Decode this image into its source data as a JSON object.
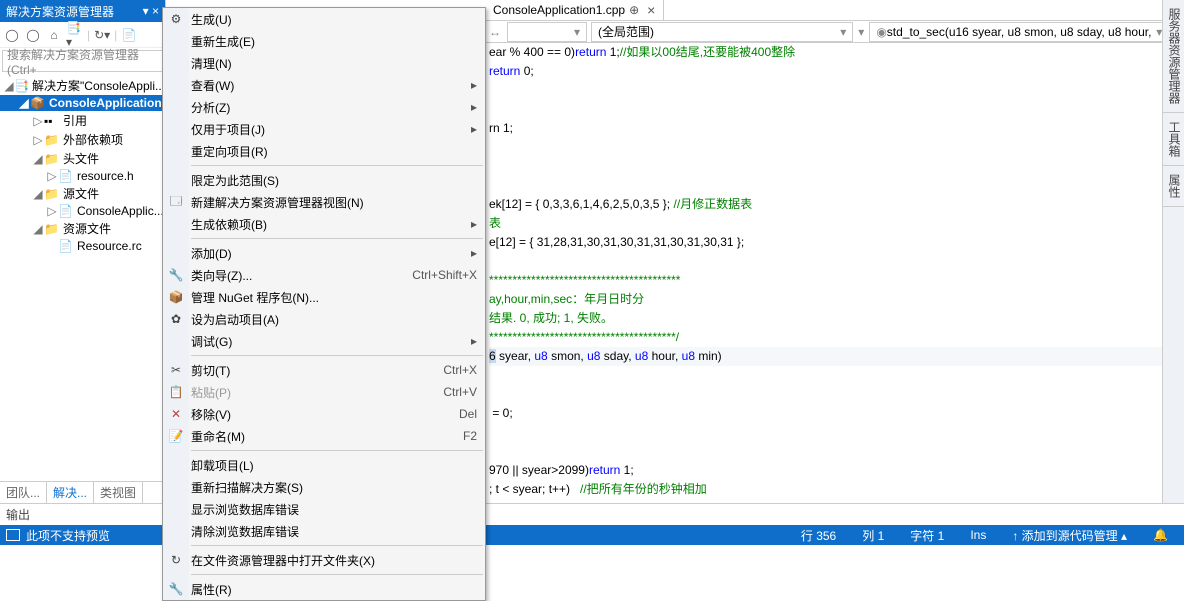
{
  "panel": {
    "title": "解决方案资源管理器",
    "search_placeholder": "搜索解决方案资源管理器(Ctrl+",
    "tabs": {
      "team": "团队...",
      "solution": "解决...",
      "classview": "类视图"
    },
    "tree": {
      "solution": "解决方案\"ConsoleAppli...",
      "project": "ConsoleApplication",
      "refs": "引用",
      "external": "外部依赖项",
      "headers": "头文件",
      "resource_h": "resource.h",
      "sources": "源文件",
      "console_cpp": "ConsoleApplic...",
      "resources": "资源文件",
      "resource_rc": "Resource.rc"
    }
  },
  "tabs": {
    "file": "ConsoleApplication1.cpp"
  },
  "nav": {
    "left": "",
    "mid": "(全局范围)",
    "right": "std_to_sec(u16 syear, u8 smon, u8 sday, u8 hour,"
  },
  "right_tabs": [
    "服务器资源管理器",
    "工具箱",
    "属性"
  ],
  "context_menu": [
    {
      "icon": "⚙",
      "label": "生成(U)"
    },
    {
      "label": "重新生成(E)"
    },
    {
      "label": "清理(N)"
    },
    {
      "label": "查看(W)",
      "sub": true
    },
    {
      "label": "分析(Z)",
      "sub": true
    },
    {
      "label": "仅用于项目(J)",
      "sub": true
    },
    {
      "label": "重定向项目(R)"
    },
    {
      "sep": true
    },
    {
      "label": "限定为此范围(S)"
    },
    {
      "icon": "🗔",
      "label": "新建解决方案资源管理器视图(N)"
    },
    {
      "label": "生成依赖项(B)",
      "sub": true
    },
    {
      "sep": true
    },
    {
      "label": "添加(D)",
      "sub": true
    },
    {
      "icon": "🔧",
      "label": "类向导(Z)...",
      "shortcut": "Ctrl+Shift+X"
    },
    {
      "icon": "📦",
      "label": "管理 NuGet 程序包(N)..."
    },
    {
      "icon": "✿",
      "label": "设为启动项目(A)"
    },
    {
      "label": "调试(G)",
      "sub": true
    },
    {
      "sep": true
    },
    {
      "icon": "✂",
      "label": "剪切(T)",
      "shortcut": "Ctrl+X"
    },
    {
      "icon": "📋",
      "label": "粘贴(P)",
      "shortcut": "Ctrl+V",
      "disabled": true
    },
    {
      "icon": "✕",
      "label": "移除(V)",
      "shortcut": "Del",
      "red": true
    },
    {
      "icon": "📝",
      "label": "重命名(M)",
      "shortcut": "F2"
    },
    {
      "sep": true
    },
    {
      "label": "卸载项目(L)"
    },
    {
      "label": "重新扫描解决方案(S)"
    },
    {
      "label": "显示浏览数据库错误"
    },
    {
      "label": "清除浏览数据库错误"
    },
    {
      "sep": true
    },
    {
      "icon": "↻",
      "label": "在文件资源管理器中打开文件夹(X)"
    },
    {
      "sep": true
    },
    {
      "icon": "🔧",
      "label": "属性(R)"
    }
  ],
  "code_lines": [
    {
      "t": "ear % 400 == 0)",
      "kw": "return",
      "n": " 1;",
      "cm": "//如果以00结尾,还要能被400整除"
    },
    {
      "kw": "return",
      "n": " 0;"
    },
    {
      "blank": true
    },
    {
      "blank": true
    },
    {
      "t": "rn 1;"
    },
    {
      "blank": true
    },
    {
      "blank": true
    },
    {
      "blank": true
    },
    {
      "t": "ek[12] = { 0,3,3,6,1,4,6,2,5,0,3,5 }; ",
      "cm": "//月修正数据表"
    },
    {
      "cm": "表"
    },
    {
      "t": "e[12] = { 31,28,31,30,31,30,31,31,30,31,30,31 };"
    },
    {
      "blank": true
    },
    {
      "cm": "*****************************************"
    },
    {
      "t": "ay,hour,min,sec：年月日时分",
      "iscm": true
    },
    {
      "t": "结果. 0, 成功; 1, 失败。",
      "iscm": true
    },
    {
      "cm": "****************************************/"
    },
    {
      "sel": true,
      "fn": true
    },
    {
      "blank": true
    },
    {
      "blank": true
    },
    {
      "t": " = 0;"
    },
    {
      "blank": true
    },
    {
      "blank": true
    },
    {
      "t": "970 || syear>2099)",
      "kw": "return",
      "n": " 1;"
    },
    {
      "t": "; t < syear; t++)   ",
      "cm": "//把所有年份的秒钟相加"
    }
  ],
  "output": "输出",
  "status": {
    "preview": "此项不支持预览",
    "line_label": "行",
    "line": "356",
    "col_label": "列",
    "col": "1",
    "char_label": "字符",
    "char": "1",
    "ins": "Ins",
    "source_control": "添加到源代码管理"
  }
}
